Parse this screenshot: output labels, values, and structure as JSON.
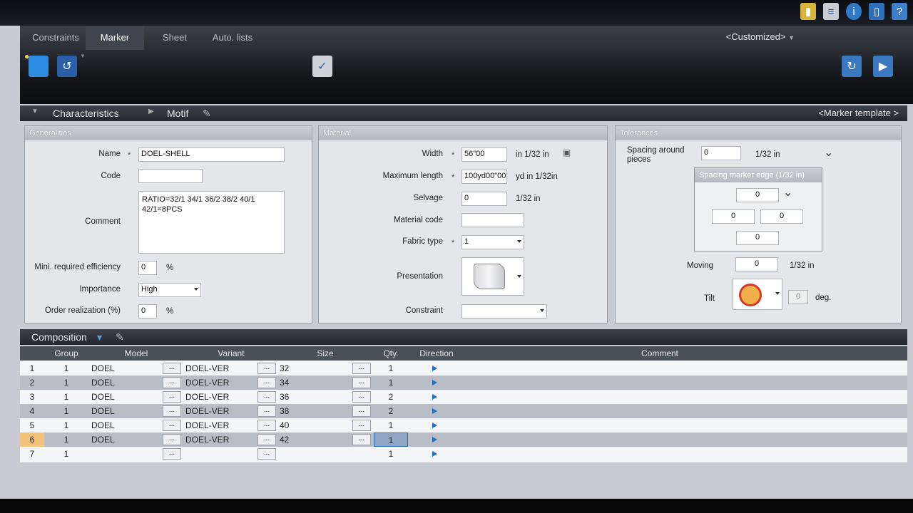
{
  "tabs": [
    {
      "label": "Constraints"
    },
    {
      "label": "Marker"
    },
    {
      "label": "Sheet"
    },
    {
      "label": "Auto. lists"
    }
  ],
  "custom_menu": "<Customized>",
  "sections": {
    "characteristics": "Characteristics",
    "motif": "Motif",
    "marker_template": "<Marker template >",
    "composition": "Composition"
  },
  "generalities": {
    "title": "Generalities",
    "name_label": "Name",
    "name_value": "DOEL-SHELL",
    "code_label": "Code",
    "code_value": "",
    "comment_label": "Comment",
    "comment_value": "RATIO=32/1 34/1 36/2 38/2 40/1\n42/1=8PCS",
    "efficiency_label": "Mini. required efficiency",
    "efficiency_value": "0",
    "efficiency_unit": "%",
    "importance_label": "Importance",
    "importance_value": "High",
    "order_label": "Order realization (%)",
    "order_value": "0",
    "order_unit": "%"
  },
  "material": {
    "title": "Material",
    "width_label": "Width",
    "width_value": "56\"00",
    "width_unit": "in 1/32 in",
    "maxlen_label": "Maximum length",
    "maxlen_value": "100yd00\"00",
    "maxlen_unit": "yd in 1/32in",
    "selvage_label": "Selvage",
    "selvage_value": "0",
    "selvage_unit": "1/32 in",
    "matcode_label": "Material code",
    "matcode_value": "",
    "fabric_label": "Fabric type",
    "fabric_value": "1",
    "presentation_label": "Presentation",
    "constraint_label": "Constraint",
    "constraint_value": ""
  },
  "tolerances": {
    "title": "Tolerances",
    "spacing_label": "Spacing around pieces",
    "spacing_value": "0",
    "spacing_unit": "1/32 in",
    "edge_title": "Spacing marker edge (1/32 in)",
    "edge_top": "0",
    "edge_left": "0",
    "edge_right": "0",
    "edge_bottom": "0",
    "moving_label": "Moving",
    "moving_value": "0",
    "moving_unit": "1/32 in",
    "tilt_label": "Tilt",
    "tilt_value": "0",
    "tilt_unit": "deg."
  },
  "grid": {
    "columns": [
      "Group",
      "Model",
      "Variant",
      "Size",
      "Qty.",
      "Direction",
      "Comment"
    ],
    "rows": [
      {
        "n": "1",
        "group": "1",
        "model": "DOEL",
        "variant": "DOEL-VER",
        "size": "32",
        "qty": "1"
      },
      {
        "n": "2",
        "group": "1",
        "model": "DOEL",
        "variant": "DOEL-VER",
        "size": "34",
        "qty": "1"
      },
      {
        "n": "3",
        "group": "1",
        "model": "DOEL",
        "variant": "DOEL-VER",
        "size": "36",
        "qty": "2"
      },
      {
        "n": "4",
        "group": "1",
        "model": "DOEL",
        "variant": "DOEL-VER",
        "size": "38",
        "qty": "2"
      },
      {
        "n": "5",
        "group": "1",
        "model": "DOEL",
        "variant": "DOEL-VER",
        "size": "40",
        "qty": "1"
      },
      {
        "n": "6",
        "group": "1",
        "model": "DOEL",
        "variant": "DOEL-VER",
        "size": "42",
        "qty": "1"
      },
      {
        "n": "7",
        "group": "1",
        "model": "",
        "variant": "",
        "size": "",
        "qty": "1"
      }
    ],
    "ellipsis": "..."
  }
}
